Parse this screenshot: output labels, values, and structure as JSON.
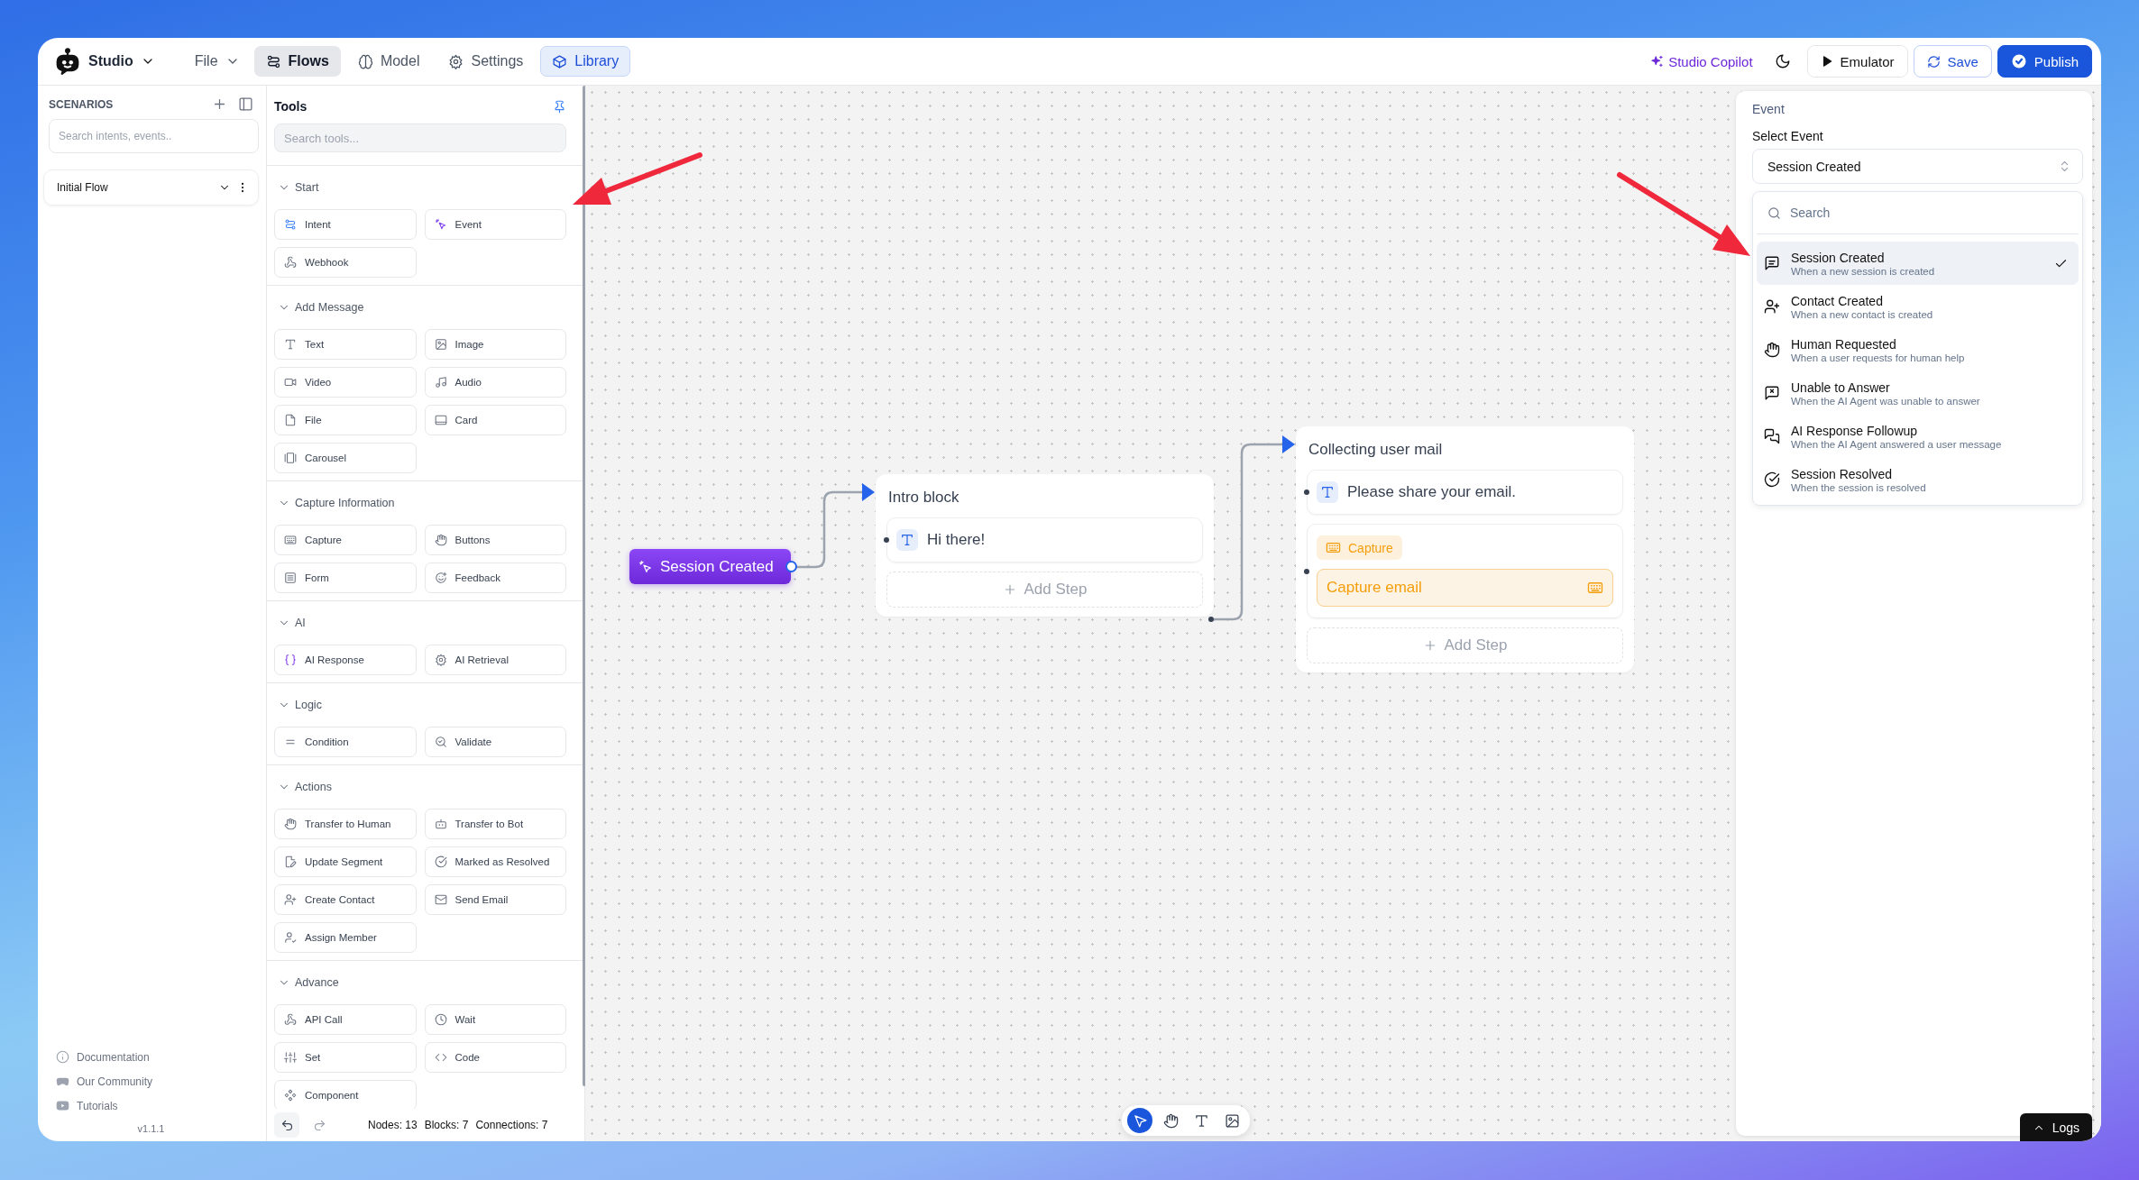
{
  "app": {
    "name": "Studio"
  },
  "menu": [
    {
      "label": "File"
    }
  ],
  "nav_tabs": [
    {
      "label": "Flows",
      "selected": true,
      "open": false
    },
    {
      "label": "Model",
      "selected": false,
      "open": false
    },
    {
      "label": "Settings",
      "selected": false,
      "open": false
    },
    {
      "label": "Library",
      "selected": false,
      "open": true
    }
  ],
  "header_actions": {
    "copilot": "Studio Copilot",
    "emulator": "Emulator",
    "save": "Save",
    "publish": "Publish"
  },
  "sidebar": {
    "title": "SCENARIOS",
    "search_placeholder": "Search intents, events..",
    "flows": [
      {
        "name": "Initial Flow"
      }
    ],
    "links": [
      {
        "label": "Documentation"
      },
      {
        "label": "Our Community"
      },
      {
        "label": "Tutorials"
      }
    ],
    "version": "v1.1.1"
  },
  "tools": {
    "title": "Tools",
    "search_placeholder": "Search tools...",
    "groups": [
      {
        "title": "Start",
        "expanded": true,
        "items": [
          "Intent",
          "Event",
          "Webhook"
        ]
      },
      {
        "title": "Add Message",
        "expanded": true,
        "items": [
          "Text",
          "Image",
          "Video",
          "Audio",
          "File",
          "Card",
          "Carousel"
        ]
      },
      {
        "title": "Capture Information",
        "expanded": true,
        "items": [
          "Capture",
          "Buttons",
          "Form",
          "Feedback"
        ]
      },
      {
        "title": "AI",
        "expanded": true,
        "items": [
          "AI Response",
          "AI Retrieval"
        ]
      },
      {
        "title": "Logic",
        "expanded": true,
        "items": [
          "Condition",
          "Validate"
        ]
      },
      {
        "title": "Actions",
        "expanded": true,
        "items": [
          "Transfer to Human",
          "Transfer to Bot",
          "Update Segment",
          "Marked as Resolved",
          "Create Contact",
          "Send Email",
          "Assign Member"
        ]
      },
      {
        "title": "Advance",
        "expanded": true,
        "items": [
          "API Call",
          "Wait",
          "Set",
          "Code",
          "Component"
        ]
      }
    ],
    "stats": [
      "Nodes: 13",
      "Blocks: 7",
      "Connections: 7"
    ]
  },
  "canvas": {
    "trigger": {
      "label": "Session Created"
    },
    "blocks": [
      {
        "title": "Intro block",
        "steps": [
          {
            "kind": "text",
            "text": "Hi there!"
          }
        ],
        "add_step": "Add Step"
      },
      {
        "title": "Collecting user mail",
        "steps": [
          {
            "kind": "text",
            "text": "Please share your email."
          },
          {
            "kind": "capture",
            "badge": "Capture",
            "text": "Capture email"
          }
        ],
        "add_step": "Add Step"
      }
    ],
    "toolbar": [
      {
        "selected": true
      },
      {
        "selected": false
      },
      {
        "selected": false
      },
      {
        "selected": false
      }
    ],
    "logs": "Logs"
  },
  "event_panel": {
    "title": "Event",
    "field_label": "Select Event",
    "value": "Session Created",
    "search_placeholder": "Search",
    "options": [
      {
        "title": "Session Created",
        "description": "When a new session is created",
        "selected": true
      },
      {
        "title": "Contact Created",
        "description": "When a new contact is created",
        "selected": false
      },
      {
        "title": "Human Requested",
        "description": "When a user requests for human help",
        "selected": false
      },
      {
        "title": "Unable to Answer",
        "description": "When the AI Agent was unable to answer",
        "selected": false
      },
      {
        "title": "AI Response Followup",
        "description": "When the AI Agent answered a user message",
        "selected": false
      },
      {
        "title": "Session Resolved",
        "description": "When the session is resolved",
        "selected": false
      }
    ]
  }
}
